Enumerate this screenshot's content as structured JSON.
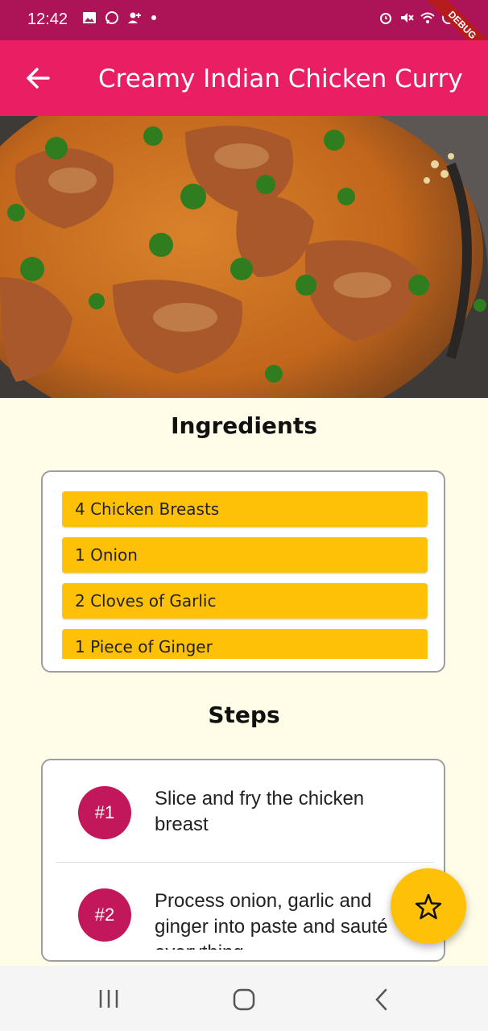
{
  "status_bar": {
    "time": "12:42",
    "left_icons": [
      "image-icon",
      "whatsapp-icon",
      "add-person-icon",
      "dot-icon"
    ],
    "right_icons": [
      "alarm-icon",
      "mute-icon",
      "wifi-icon",
      "no-sim-icon",
      "battery-icon"
    ],
    "debug_label": "DEBUG"
  },
  "app_bar": {
    "title": "Creamy Indian Chicken Curry",
    "back_icon": "arrow-back-icon"
  },
  "ingredients": {
    "title": "Ingredients",
    "items": [
      "4 Chicken Breasts",
      "1 Onion",
      "2 Cloves of Garlic",
      "1 Piece of Ginger"
    ]
  },
  "steps": {
    "title": "Steps",
    "items": [
      {
        "number": "#1",
        "text": "Slice and fry the chicken breast"
      },
      {
        "number": "#2",
        "text": "Process onion, garlic and ginger into paste and sauté everything"
      }
    ]
  },
  "fab": {
    "icon": "star-outline-icon"
  },
  "nav_bar": {
    "icons": [
      "recent-apps-icon",
      "home-icon",
      "back-nav-icon"
    ]
  },
  "colors": {
    "status_bar": "#ad1457",
    "app_bar": "#e91e63",
    "background": "#fffde7",
    "ingredient_chip": "#ffc107",
    "step_avatar": "#c2185b",
    "fab": "#ffc107"
  }
}
